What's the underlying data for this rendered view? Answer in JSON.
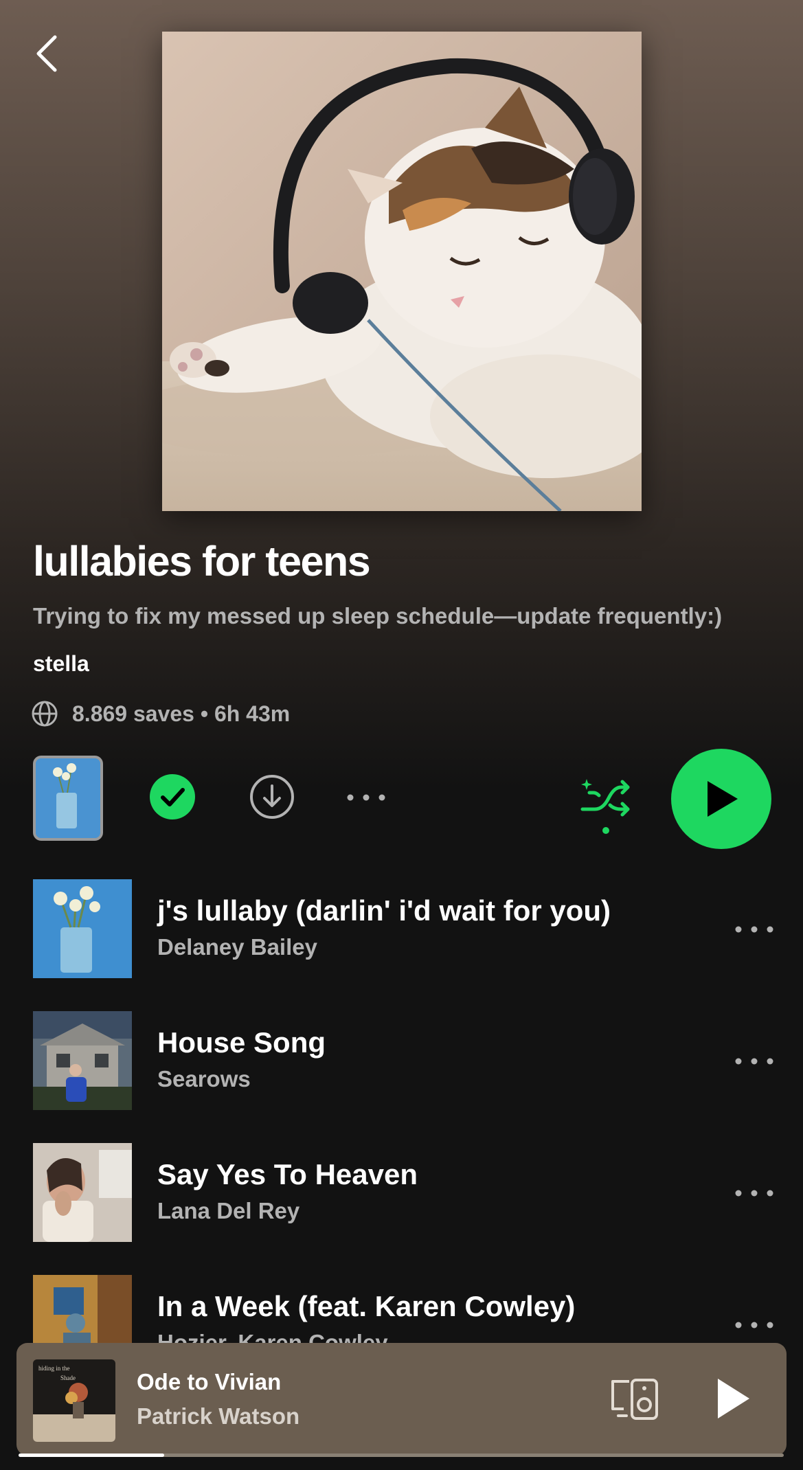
{
  "playlist": {
    "title": "lullabies for teens",
    "description": "Trying to fix my messed up sleep schedule—update frequently:)",
    "owner": "stella",
    "meta": "8.869 saves • 6h 43m"
  },
  "icons": {
    "back": "chevron-left-icon",
    "globe": "globe-icon",
    "saved": "check-circle-icon",
    "download": "download-icon",
    "more": "more-horizontal-icon",
    "shuffle": "shuffle-icon",
    "play": "play-icon",
    "devices": "devices-icon"
  },
  "colors": {
    "accent": "#1ed760",
    "background": "#121212",
    "mini_player": "#6b5e50"
  },
  "tracks": [
    {
      "title": "j's lullaby (darlin' i'd wait for you)",
      "artist": "Delaney Bailey"
    },
    {
      "title": "House Song",
      "artist": "Searows"
    },
    {
      "title": "Say Yes To Heaven",
      "artist": "Lana Del Rey"
    },
    {
      "title": "In a Week (feat. Karen Cowley)",
      "artist": "Hozier, Karen Cowley"
    }
  ],
  "now_playing": {
    "title": "Ode to Vivian",
    "artist": "Patrick Watson",
    "progress": 0.19
  }
}
